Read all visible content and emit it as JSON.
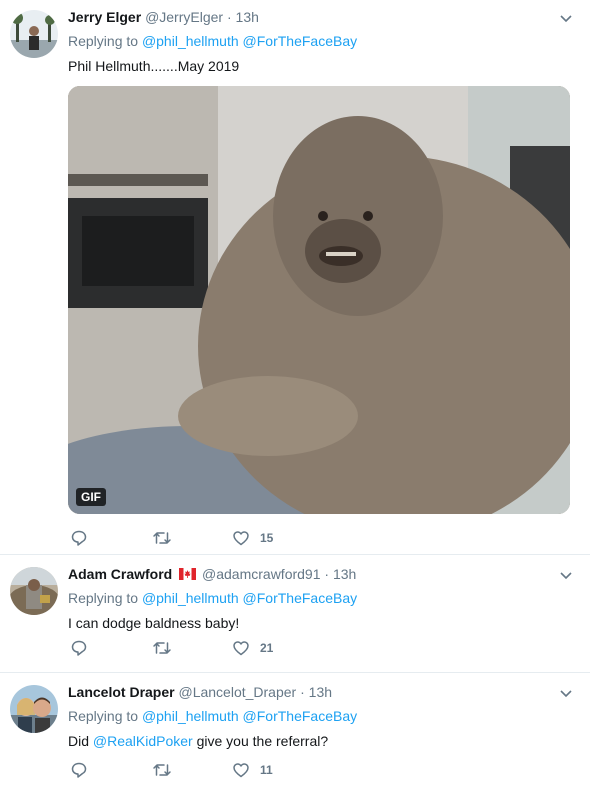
{
  "tweets": [
    {
      "name": "Jerry Elger",
      "handle": "@JerryElger",
      "dot": "·",
      "time": "13h",
      "replying_prefix": "Replying to",
      "reply_targets": [
        "@phil_hellmuth",
        "@ForTheFaceBay"
      ],
      "text": "Phil Hellmuth.......May 2019",
      "media_badge": "GIF",
      "likes": "15"
    },
    {
      "name": "Adam Crawford",
      "handle": "@adamcrawford91",
      "dot": "·",
      "time": "13h",
      "replying_prefix": "Replying to",
      "reply_targets": [
        "@phil_hellmuth",
        "@ForTheFaceBay"
      ],
      "text": "I can dodge baldness baby!",
      "likes": "21"
    },
    {
      "name": "Lancelot Draper",
      "handle": "@Lancelot_Draper",
      "dot": "·",
      "time": "13h",
      "replying_prefix": "Replying to",
      "reply_targets": [
        "@phil_hellmuth",
        "@ForTheFaceBay"
      ],
      "text_before": "Did",
      "text_mention": "@RealKidPoker",
      "text_after": "give you the referral?",
      "likes": "11"
    }
  ],
  "colors": {
    "link": "#1da1f2",
    "muted": "#657786",
    "text": "#14171a",
    "divider": "#e6ecf0"
  },
  "icons": {
    "reply": "reply-icon",
    "retweet": "retweet-icon",
    "like": "heart-icon",
    "menu": "chevron-down-icon",
    "flag": "canada-flag-icon"
  }
}
